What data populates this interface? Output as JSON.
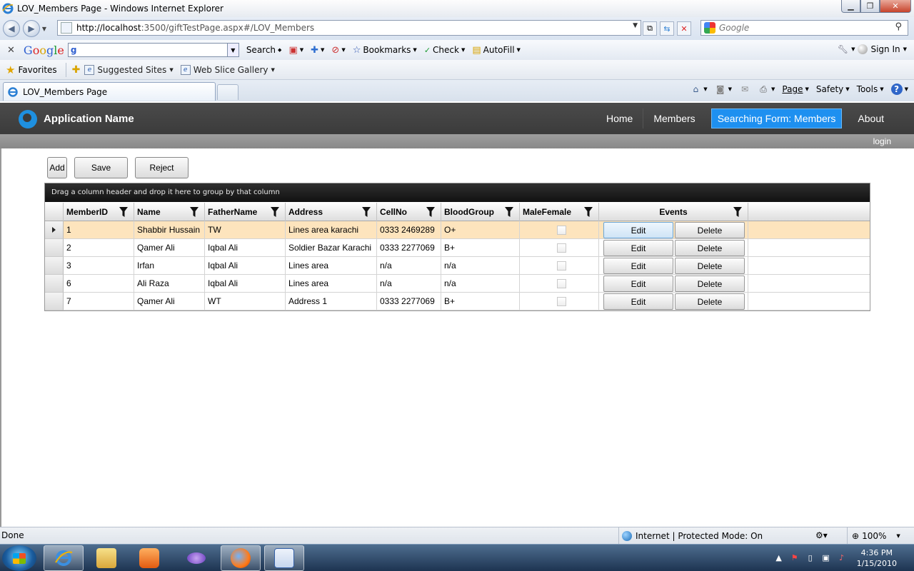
{
  "window": {
    "title": "LOV_Members Page - Windows Internet Explorer",
    "min_glyph": "▁",
    "max_glyph": "❐",
    "close_glyph": "✕"
  },
  "address_bar": {
    "url_host": "http://localhost",
    "url_rest": ":3500/giftTestPage.aspx#/LOV_Members",
    "search_placeholder": "Google"
  },
  "google_toolbar": {
    "close_glyph": "✕",
    "logo_g": "G",
    "logo_o1": "o",
    "logo_o2": "o",
    "logo_g2": "g",
    "logo_l": "l",
    "logo_e": "e",
    "search_label": "Search",
    "bookmarks_label": "Bookmarks",
    "check_label": "Check",
    "autofill_label": "AutoFill",
    "signin_label": "Sign In"
  },
  "favorites_bar": {
    "favorites_label": "Favorites",
    "suggested_sites_label": "Suggested Sites",
    "web_slice_label": "Web Slice Gallery"
  },
  "tabs": {
    "active_tab_label": "LOV_Members Page"
  },
  "command_bar": {
    "page_label": "Page",
    "safety_label": "Safety",
    "tools_label": "Tools"
  },
  "app": {
    "name": "Application Name",
    "nav": {
      "home": "Home",
      "members": "Members",
      "searching": "Searching Form: Members",
      "about": "About"
    },
    "login": "login",
    "buttons": {
      "add": "Add",
      "save": "Save",
      "reject": "Reject"
    },
    "grid": {
      "group_hint": "Drag a column header and drop it here to group by that column",
      "columns": {
        "member_id": "MemberID",
        "name": "Name",
        "father_name": "FatherName",
        "address": "Address",
        "cell_no": "CellNo",
        "blood_group": "BloodGroup",
        "male_female": "MaleFemale",
        "events": "Events"
      },
      "edit_label": "Edit",
      "delete_label": "Delete",
      "rows": [
        {
          "member_id": "1",
          "name": "Shabbir Hussain",
          "father_name": "TW",
          "address": "Lines area karachi",
          "cell_no": "0333 2469289",
          "blood_group": "O+"
        },
        {
          "member_id": "2",
          "name": "Qamer Ali",
          "father_name": "Iqbal Ali",
          "address": "Soldier Bazar Karachi",
          "cell_no": "0333 2277069",
          "blood_group": "B+"
        },
        {
          "member_id": "3",
          "name": "Irfan",
          "father_name": "Iqbal Ali",
          "address": "Lines area",
          "cell_no": "n/a",
          "blood_group": "n/a"
        },
        {
          "member_id": "6",
          "name": "Ali Raza",
          "father_name": "Iqbal Ali",
          "address": "Lines area",
          "cell_no": "n/a",
          "blood_group": "n/a"
        },
        {
          "member_id": "7",
          "name": "Qamer Ali",
          "father_name": "WT",
          "address": "Address 1",
          "cell_no": "0333 2277069",
          "blood_group": "B+"
        }
      ]
    }
  },
  "status_bar": {
    "status": "Done",
    "zone": "Internet | Protected Mode: On",
    "zoom": "100%"
  },
  "taskbar": {
    "time": "4:36 PM",
    "date": "1/15/2010"
  }
}
